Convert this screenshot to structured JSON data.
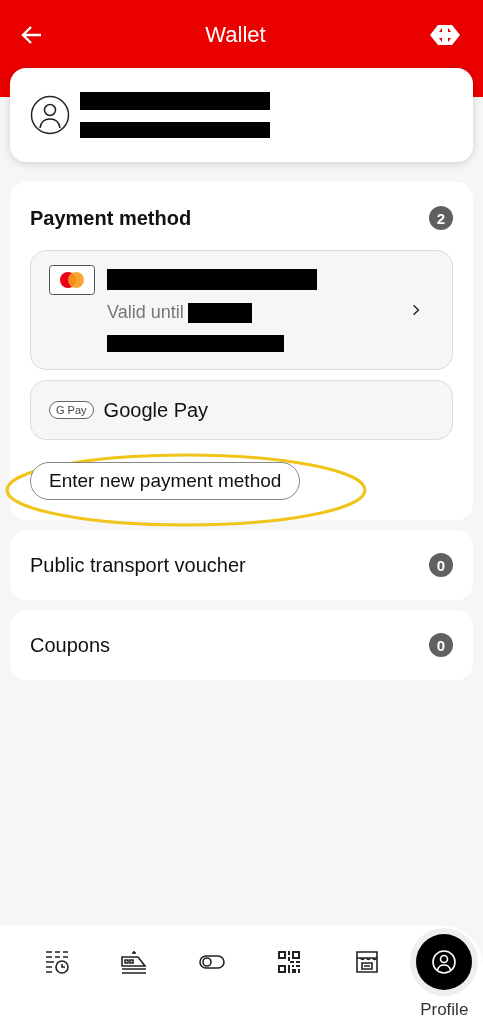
{
  "header": {
    "title": "Wallet"
  },
  "payment": {
    "title": "Payment method",
    "count": "2",
    "methods": [
      {
        "kind": "mastercard",
        "valid_label": "Valid until"
      },
      {
        "kind": "google_pay",
        "logo": "G Pay",
        "name": "Google Pay"
      }
    ],
    "add_button": {
      "label": "Enter new payment method",
      "highlighted": true
    }
  },
  "sections": [
    {
      "title": "Public transport voucher",
      "count": "0"
    },
    {
      "title": "Coupons",
      "count": "0"
    }
  ],
  "nav": [
    {
      "kind": "timetable",
      "selected": false
    },
    {
      "kind": "train",
      "selected": false
    },
    {
      "kind": "toggle",
      "selected": false
    },
    {
      "kind": "qr",
      "selected": false
    },
    {
      "kind": "shop",
      "selected": false
    },
    {
      "kind": "profile",
      "label": "Profile",
      "selected": true
    }
  ]
}
